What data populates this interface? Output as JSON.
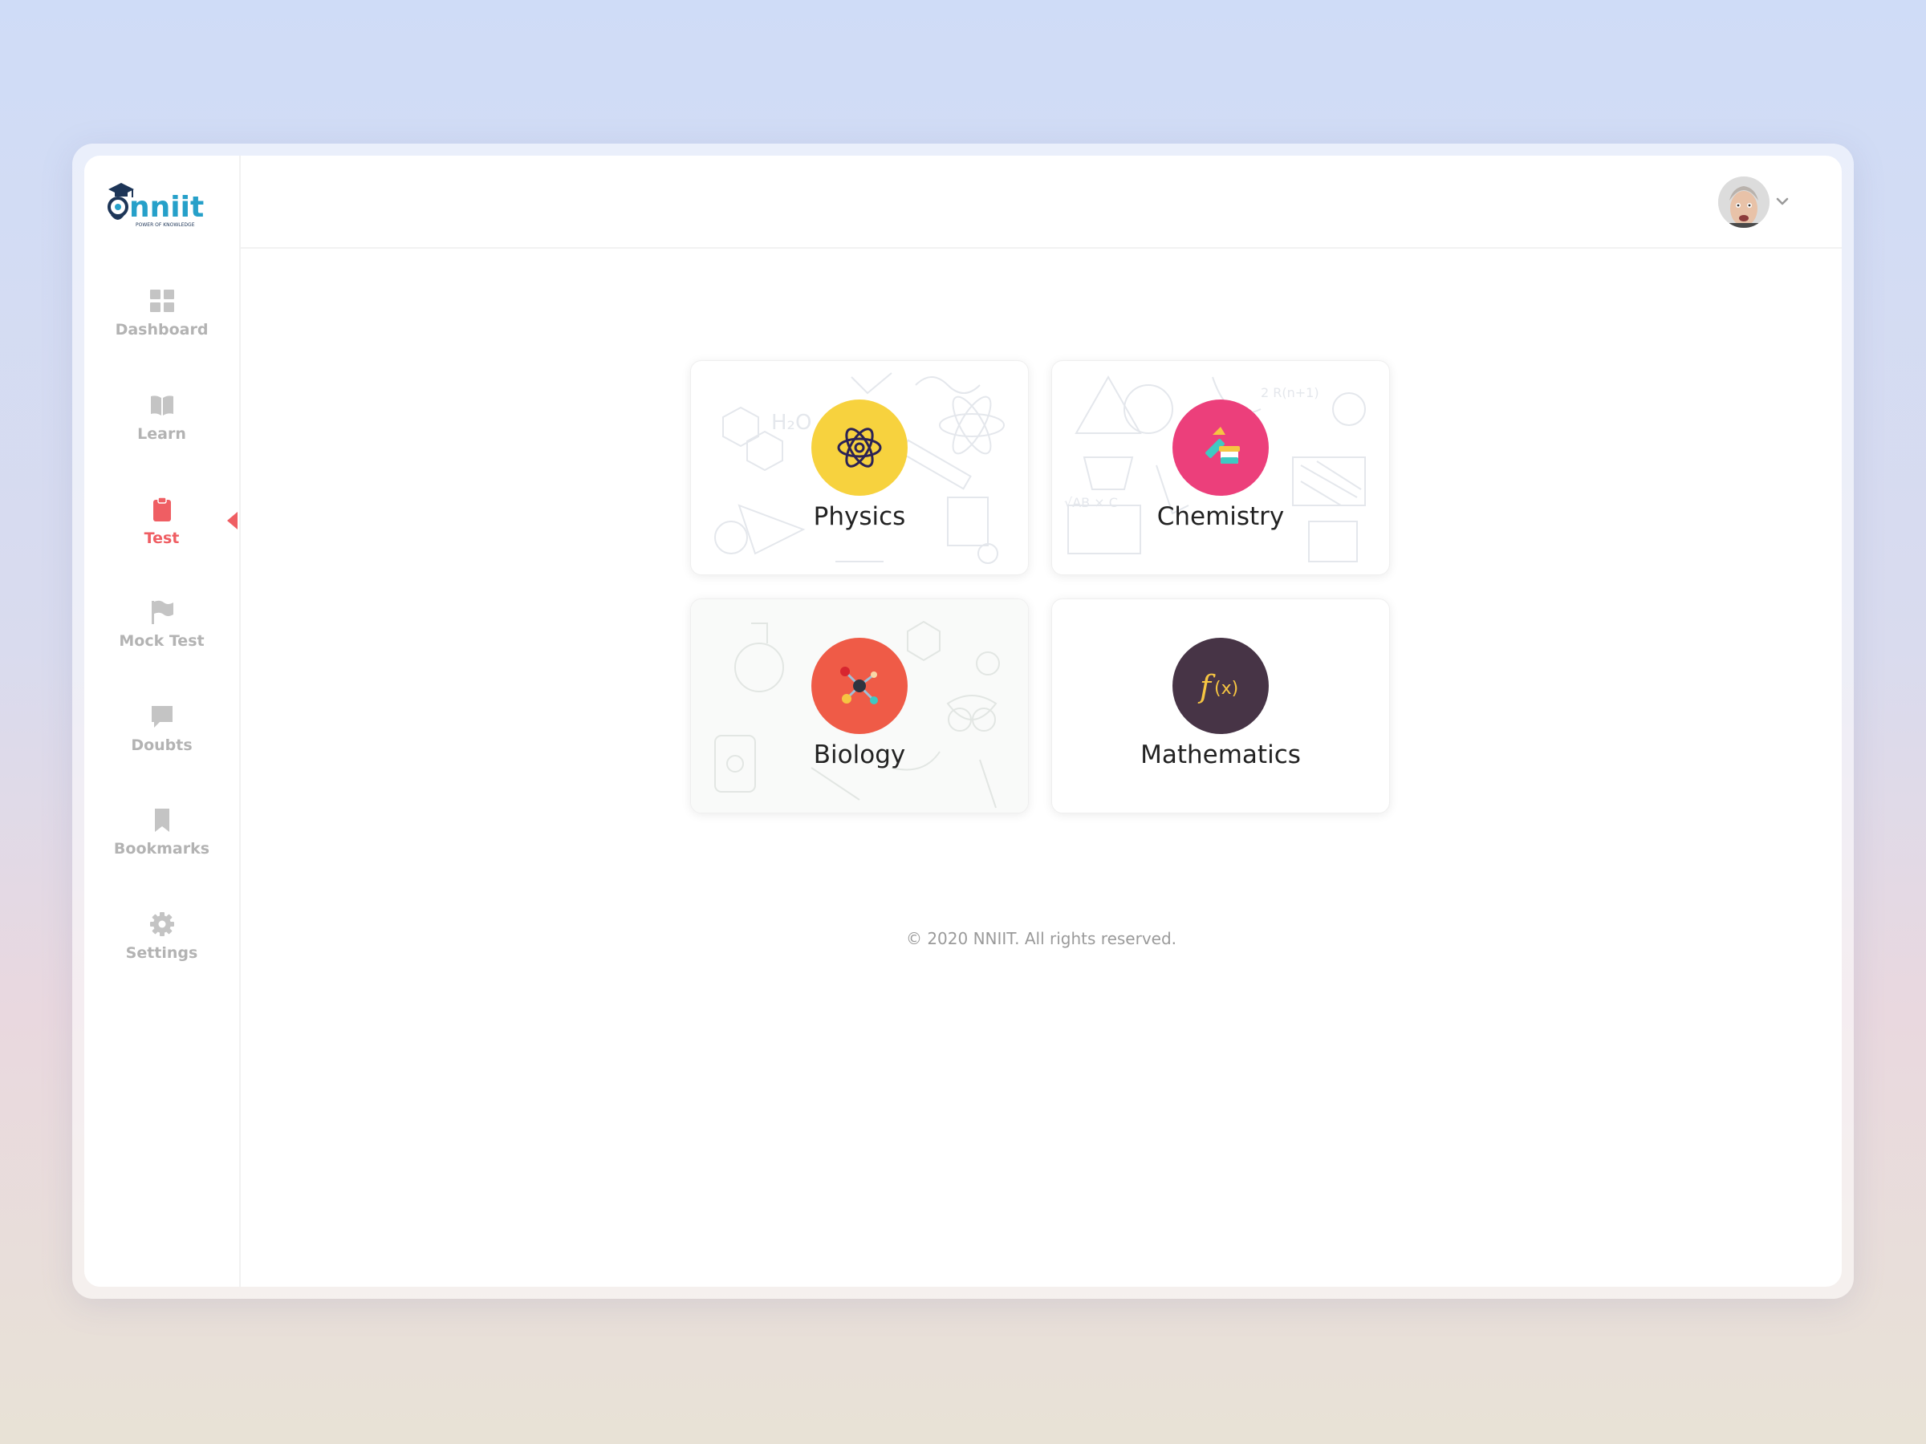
{
  "app": {
    "logo_text": "nniit",
    "logo_tagline": "POWER OF KNOWLEDGE"
  },
  "sidebar": {
    "items": [
      {
        "label": "Dashboard",
        "icon": "dashboard-grid-icon"
      },
      {
        "label": "Learn",
        "icon": "book-icon"
      },
      {
        "label": "Test",
        "icon": "clipboard-icon",
        "active": true
      },
      {
        "label": "Mock Test",
        "icon": "flag-icon"
      },
      {
        "label": "Doubts",
        "icon": "chat-bubble-icon"
      },
      {
        "label": "Bookmarks",
        "icon": "bookmark-icon"
      },
      {
        "label": "Settings",
        "icon": "gear-icon"
      }
    ],
    "active_color": "#ef5e63",
    "inactive_color": "#b3b3b3"
  },
  "header": {
    "avatar": "user-avatar",
    "menu_icon": "chevron-down-icon"
  },
  "subjects": [
    {
      "label": "Physics",
      "icon": "atom-icon",
      "color": "#f7d23e"
    },
    {
      "label": "Chemistry",
      "icon": "flask-icon",
      "color": "#ec3f7b"
    },
    {
      "label": "Biology",
      "icon": "molecule-icon",
      "color": "#ef5b47"
    },
    {
      "label": "Mathematics",
      "icon": "function-icon",
      "color": "#473446"
    }
  ],
  "footer": {
    "text": "© 2020 NNIIT. All rights reserved."
  }
}
